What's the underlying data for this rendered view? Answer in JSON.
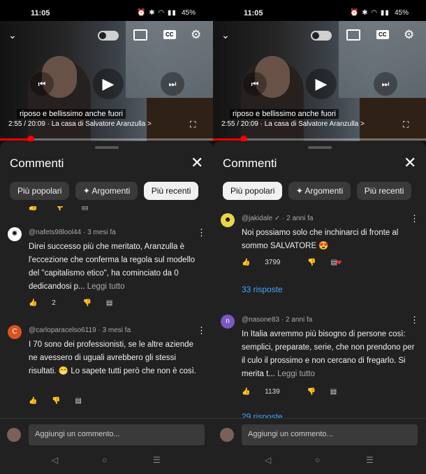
{
  "left": {
    "status": {
      "time": "11:05",
      "icons": "⏰ ✱ ◠ ▮▮",
      "battery": "45%"
    },
    "video": {
      "subtitle": "riposo e bellissimo anche fuori",
      "time_info": "2:55 / 20:09 · La casa di Salvatore Aranzulla >",
      "progress_fraction": 0.145
    },
    "sheet": {
      "title": "Commenti",
      "chips": [
        {
          "label": "Più popolari",
          "active": false
        },
        {
          "label": "✦ Argomenti",
          "active": false
        },
        {
          "label": "Più recenti",
          "active": true
        }
      ],
      "comments": [
        {
          "author": "@nafets98lool44 · 3 mesi fa",
          "avatar_color": "#ffffff",
          "avatar_letter": "",
          "text": "Direi successo più che meritato, Aranzulla è l'eccezione che conferma la regola sul modello del \"capitalismo etico\", ha cominciato da 0 dedicandosi p...",
          "read_more": "Leggi tutto",
          "likes": "2"
        },
        {
          "author": "@carloparacelso6119 · 3 mesi fa",
          "avatar_color": "#d9541f",
          "avatar_letter": "C",
          "text": "I 70 sono dei professionisti, se le altre aziende ne avessero di uguali avrebbero gli stessi risultati. 😁 Lo sapete tutti però che non è così.",
          "read_more": "",
          "likes": ""
        }
      ],
      "composer_placeholder": "Aggiungi un commento..."
    }
  },
  "right": {
    "status": {
      "time": "11:05",
      "icons": "⏰ ✱ ◠ ▮▮",
      "battery": "45%"
    },
    "video": {
      "subtitle": "riposo e bellissimo anche fuori",
      "time_info": "2:55 / 20:09 · La casa di Salvatore Aranzulla >",
      "progress_fraction": 0.145
    },
    "sheet": {
      "title": "Commenti",
      "chips": [
        {
          "label": "Più popolari",
          "active": true
        },
        {
          "label": "✦ Argomenti",
          "active": false
        },
        {
          "label": "Più recenti",
          "active": false
        }
      ],
      "comments": [
        {
          "author": "@jakidale ✓ · 2 anni fa",
          "avatar_color": "#e8d54a",
          "avatar_letter": "",
          "text": "Noi possiamo solo che inchinarci di fronte al sommo SALVATORE 😍",
          "read_more": "",
          "likes": "3799",
          "replies": "33 risposte"
        },
        {
          "author": "@nasone83 · 2 anni fa",
          "avatar_color": "#7b57c2",
          "avatar_letter": "n",
          "text": "In Italia avremmo più bisogno di persone così: semplici, preparate, serie, che non prendono per il culo il prossimo e non cercano di fregarlo. Si merita t...",
          "read_more": "Leggi tutto",
          "likes": "1139",
          "replies": "29 risposte"
        }
      ],
      "composer_placeholder": "Aggiungi un commento..."
    }
  },
  "icons": {
    "collapse": "⌄",
    "cast": "cast-icon",
    "cc": "CC",
    "settings": "⚙",
    "prev": "⏮",
    "play": "▶",
    "next": "⏭",
    "fullscreen": "⛶",
    "close": "✕",
    "more": "⋮",
    "like": "👍",
    "dislike": "👎",
    "reply": "▤",
    "nav_back": "◁",
    "nav_home": "○",
    "nav_recent": "☰"
  },
  "colors": {
    "accent_red": "#ff0000",
    "link_blue": "#3ea6ff"
  }
}
